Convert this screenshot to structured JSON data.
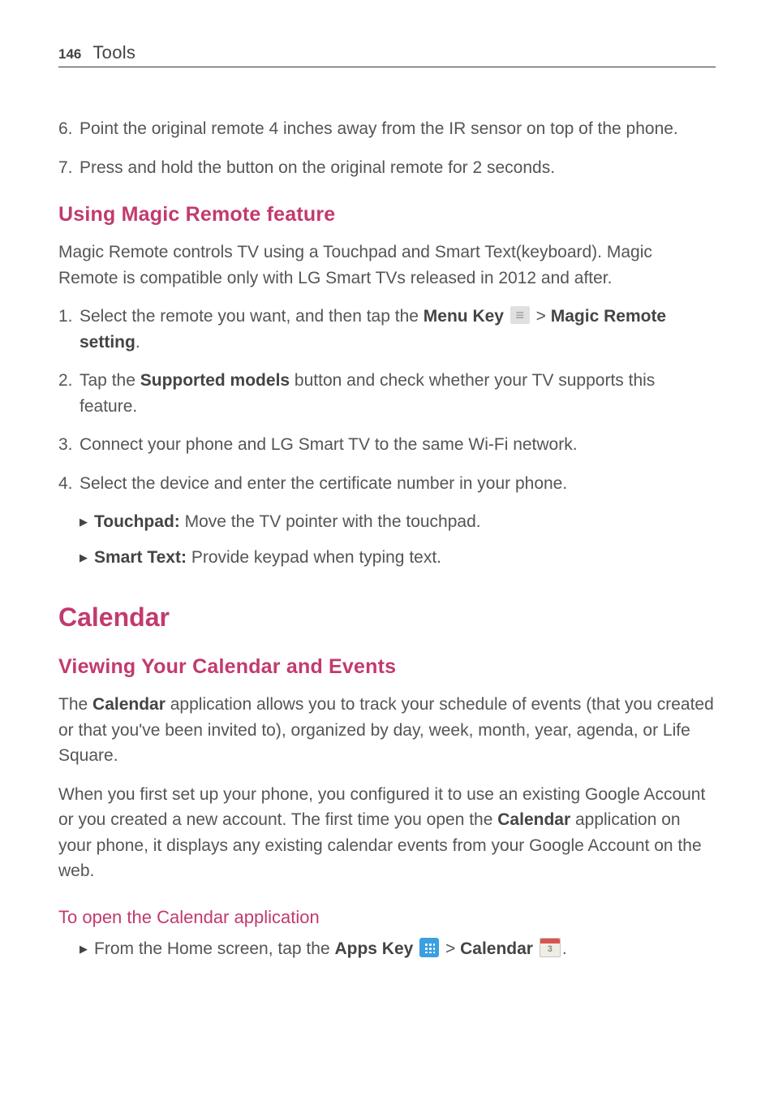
{
  "header": {
    "page_number": "146",
    "title": "Tools"
  },
  "step6": {
    "num": "6.",
    "text": "Point the original remote 4 inches away from the IR sensor on top of the phone."
  },
  "step7": {
    "num": "7.",
    "text": "Press and hold the button on the original remote for 2 seconds."
  },
  "magic_remote": {
    "heading": "Using Magic Remote feature",
    "intro": "Magic Remote controls TV using a Touchpad and Smart Text(keyboard). Magic Remote is compatible only with LG Smart TVs released in 2012 and after.",
    "step1": {
      "num": "1.",
      "pre": "Select the remote you want, and then tap the ",
      "bold1": "Menu Key ",
      "gt": " > ",
      "bold2": "Magic Remote setting",
      "post": "."
    },
    "step2": {
      "num": "2.",
      "pre": "Tap the ",
      "bold": "Supported models",
      "post": " button and check whether your TV supports this feature."
    },
    "step3": {
      "num": "3.",
      "text": "Connect your phone and LG Smart TV to the same Wi-Fi network."
    },
    "step4": {
      "num": "4.",
      "text": "Select the device and enter the certificate number in your phone."
    },
    "touchpad": {
      "bold": "Touchpad:",
      "text": " Move the TV pointer with the touchpad."
    },
    "smarttext": {
      "bold": "Smart Text:",
      "text": " Provide keypad when typing text."
    }
  },
  "calendar": {
    "heading": "Calendar",
    "sub_heading": "Viewing Your Calendar and Events",
    "para1_pre": "The ",
    "para1_bold": "Calendar",
    "para1_post": " application allows you to track your schedule of events (that you created or that you've been invited to), organized by day, week, month, year, agenda, or Life Square.",
    "para2_pre": "When you first set up your phone, you configured it to use an existing Google Account or you created a new account. The first time you open the ",
    "para2_bold": "Calendar",
    "para2_post": " application on your phone, it displays any existing calendar events from your Google Account on the web.",
    "open_heading": "To open the Calendar application",
    "open_step": {
      "pre": "From the Home screen, tap the ",
      "bold1": "Apps Key ",
      "gt": " > ",
      "bold2": "Calendar ",
      "post": "."
    },
    "cal_icon_num": "3"
  }
}
